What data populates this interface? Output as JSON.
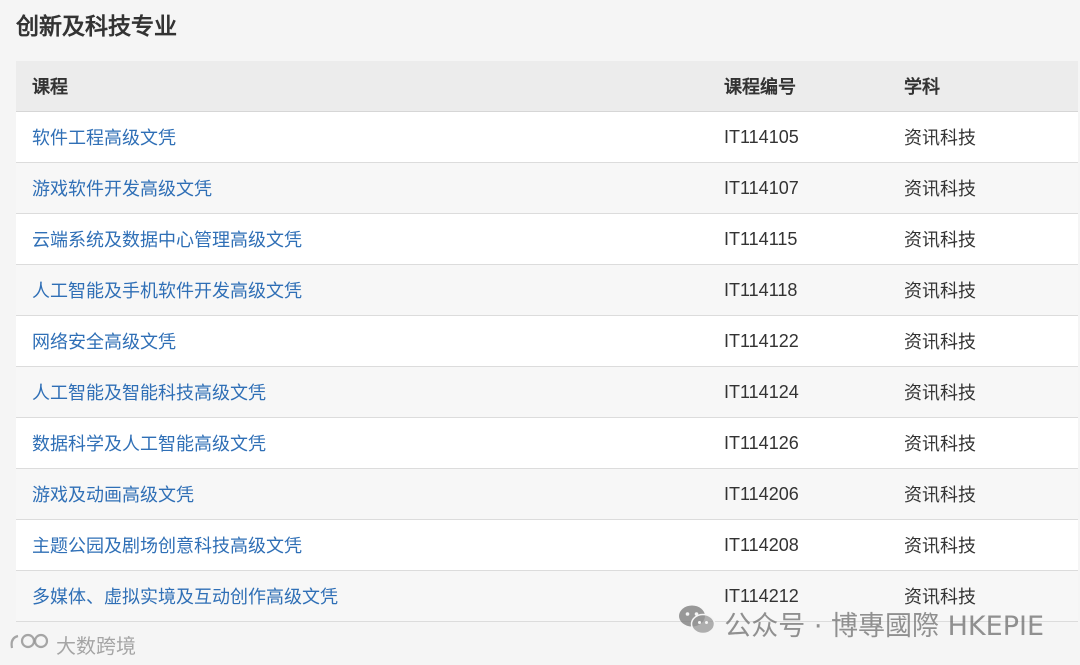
{
  "section": {
    "title": "创新及科技专业"
  },
  "table": {
    "headers": {
      "course": "课程",
      "code": "课程编号",
      "subject": "学科"
    },
    "rows": [
      {
        "course": "软件工程高级文凭",
        "code": "IT114105",
        "subject": "资讯科技"
      },
      {
        "course": "游戏软件开发高级文凭",
        "code": "IT114107",
        "subject": "资讯科技"
      },
      {
        "course": "云端系统及数据中心管理高级文凭",
        "code": "IT114115",
        "subject": "资讯科技"
      },
      {
        "course": "人工智能及手机软件开发高级文凭",
        "code": "IT114118",
        "subject": "资讯科技"
      },
      {
        "course": "网络安全高级文凭",
        "code": "IT114122",
        "subject": "资讯科技"
      },
      {
        "course": "人工智能及智能科技高级文凭",
        "code": "IT114124",
        "subject": "资讯科技"
      },
      {
        "course": "数据科学及人工智能高级文凭",
        "code": "IT114126",
        "subject": "资讯科技"
      },
      {
        "course": "游戏及动画高级文凭",
        "code": "IT114206",
        "subject": "资讯科技"
      },
      {
        "course": "主题公园及剧场创意科技高级文凭",
        "code": "IT114208",
        "subject": "资讯科技"
      },
      {
        "course": "多媒体、虚拟实境及互动创作高级文凭",
        "code": "IT114212",
        "subject": "资讯科技"
      }
    ]
  },
  "watermarks": {
    "right_text": "公众号 · 博專國際 HKEPIE",
    "right_icon": "wechat-icon",
    "left_text": "大数跨境",
    "left_icon": "brand-logo-icon"
  },
  "colors": {
    "link": "#2f6fb6",
    "header_bg": "#ececec"
  }
}
